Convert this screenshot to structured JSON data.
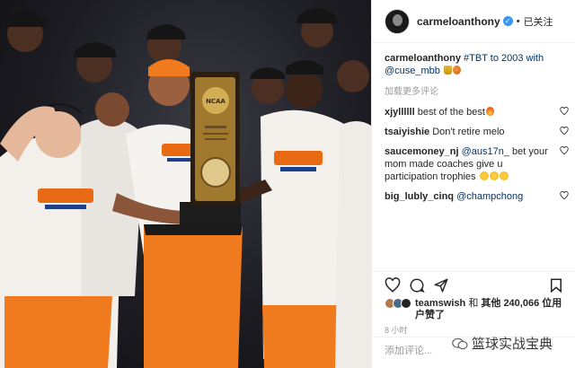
{
  "header": {
    "username": "carmeloanthony",
    "separator": "•",
    "follow_status": "已关注"
  },
  "caption": {
    "username": "carmeloanthony",
    "text_part1": "#TBT to 2003 with",
    "mention": "@cuse_mbb",
    "emoji_1": "trophy",
    "emoji_2": "basketball"
  },
  "load_more": "加载更多评论",
  "comments": [
    {
      "username": "xjyllllll",
      "text": "best of the best",
      "emoji": "fire"
    },
    {
      "username": "tsaiyishie",
      "text": "Don't retire melo"
    },
    {
      "username": "saucemoney_nj",
      "mention": "@aus17n_",
      "text": "bet your mom made coaches give u participation trophies",
      "emoji": "laughing x3"
    },
    {
      "username": "big_lubly_cinq",
      "mention": "@champchong"
    }
  ],
  "likes": {
    "user": "teamswish",
    "text_and": "和",
    "text_others": "其他",
    "count": "240,066",
    "text_suffix": "位用户赞了"
  },
  "timestamp": "8 小时",
  "add_comment_placeholder": "添加评论...",
  "watermark": "篮球实战宝典",
  "photo_trophy_text": "NCAA",
  "colors": {
    "verified": "#3897f0",
    "link": "#003569",
    "muted": "#999999",
    "jersey_orange": "#f07a1e"
  }
}
